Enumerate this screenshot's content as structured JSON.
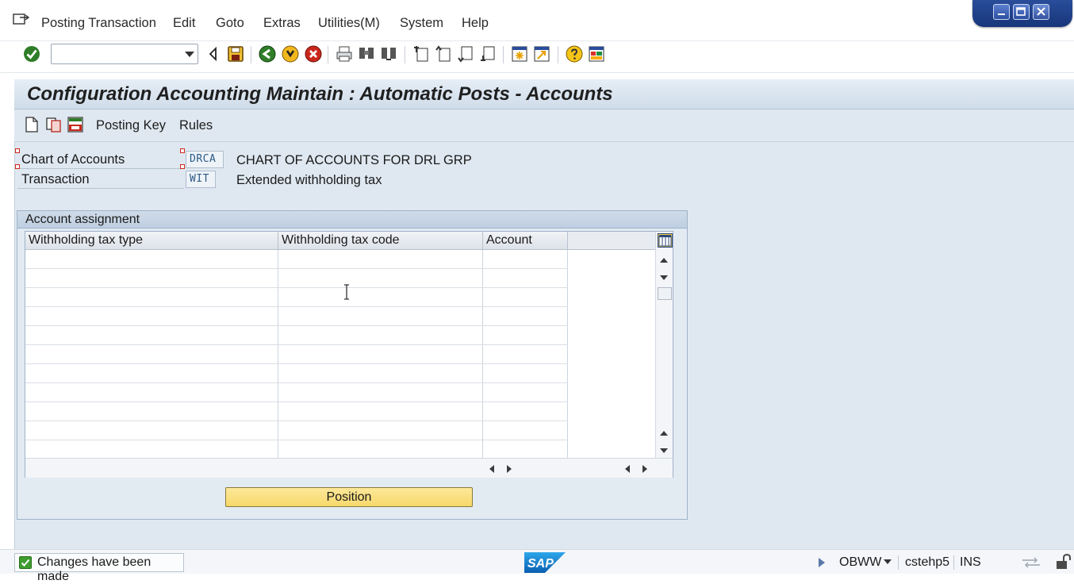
{
  "menubar": {
    "items": [
      {
        "label": "Posting Transaction",
        "underline": "P"
      },
      {
        "label": "Edit",
        "underline": "E"
      },
      {
        "label": "Goto",
        "underline": "G"
      },
      {
        "label": "Extras",
        "underline": "x"
      },
      {
        "label": "Utilities(M)",
        "underline": "M"
      },
      {
        "label": "System",
        "underline": "S"
      },
      {
        "label": "Help",
        "underline": "H"
      }
    ]
  },
  "toolbar": {
    "command_field_value": "",
    "icons": [
      "enter-icon",
      "back-icon",
      "save-icon",
      "back-green-icon",
      "exit-icon",
      "cancel-icon",
      "print-icon",
      "find-icon",
      "find-next-icon",
      "first-page-icon",
      "previous-page-icon",
      "next-page-icon",
      "last-page-icon",
      "create-session-icon",
      "shortcut-icon",
      "help-icon",
      "customize-layout-icon"
    ]
  },
  "title": "Configuration Accounting Maintain : Automatic Posts - Accounts",
  "app_toolbar": {
    "icons": [
      "new-entries-icon",
      "copy-icon",
      "save-list-icon"
    ],
    "posting_key_label": "Posting Key",
    "rules_label": "Rules"
  },
  "header": {
    "chart_of_accounts": {
      "label": "Chart of Accounts",
      "value": "DRCA",
      "description": "CHART OF ACCOUNTS FOR DRL GRP"
    },
    "transaction": {
      "label": "Transaction",
      "value": "WIT",
      "description": "Extended withholding tax"
    }
  },
  "account_assignment": {
    "title": "Account assignment",
    "columns": [
      "Withholding tax type",
      "Withholding tax code",
      "Account"
    ],
    "rows": [
      [
        "",
        "",
        ""
      ],
      [
        "",
        "",
        ""
      ],
      [
        "",
        "",
        ""
      ],
      [
        "",
        "",
        ""
      ],
      [
        "",
        "",
        ""
      ],
      [
        "",
        "",
        ""
      ],
      [
        "",
        "",
        ""
      ],
      [
        "",
        "",
        ""
      ],
      [
        "",
        "",
        ""
      ],
      [
        "",
        "",
        ""
      ],
      [
        "",
        "",
        ""
      ]
    ],
    "position_button_label": "Position"
  },
  "statusbar": {
    "message": "Changes have been made",
    "transaction_code": "OBWW",
    "server": "cstehp5",
    "mode": "INS",
    "logo_text": "SAP"
  },
  "colors": {
    "accent": "#2a4d9a",
    "app_background": "#dfe8f1",
    "button_yellow": "#f6d86a",
    "success_green": "#3f9d2e"
  }
}
